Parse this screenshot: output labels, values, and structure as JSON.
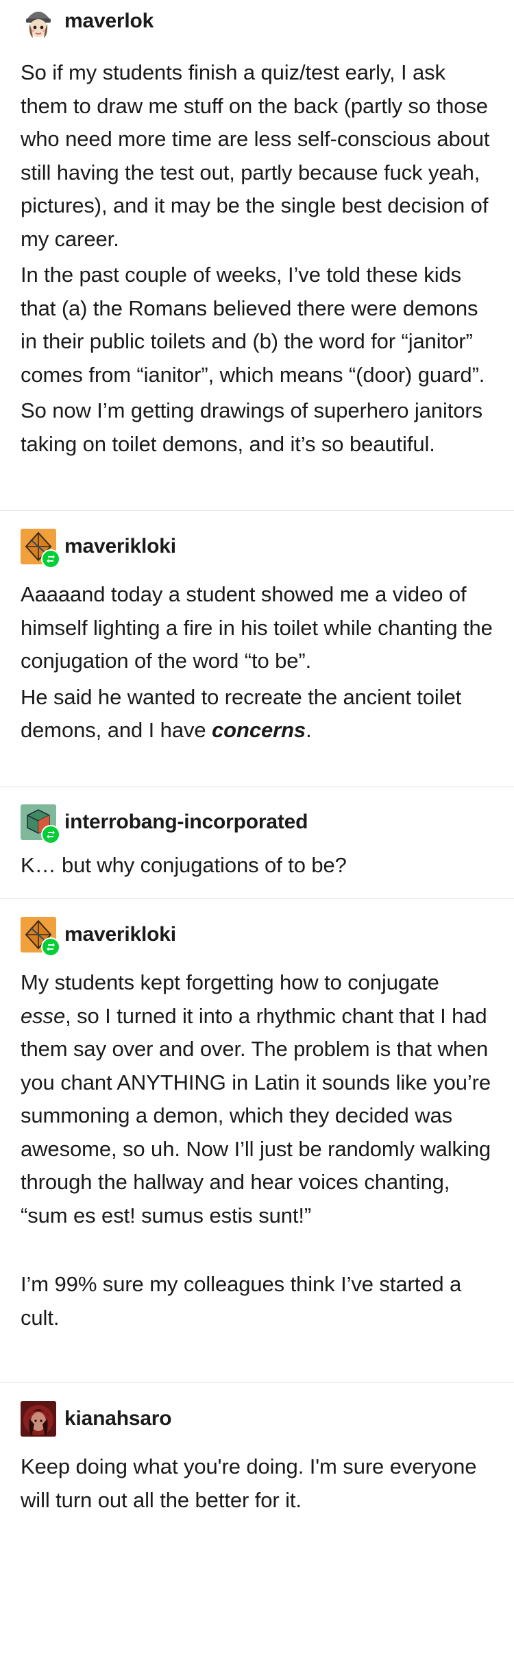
{
  "posts": [
    {
      "username": "maverlok",
      "avatar_icon": "girl-with-cap-avatar-icon",
      "paragraphs": [
        "So if my students finish a quiz/test early, I ask them to draw me stuff on the back (partly so those who need more time are less self-conscious about still having the test out, partly because fuck yeah, pictures), and it may be the single best decision of my career.",
        "In the past couple of weeks, I’ve told these kids that (a) the Romans believed there were demons in their public toilets and (b) the word for “janitor” comes from “ianitor”, which means “(door) guard”.",
        "So now I’m getting drawings of superhero janitors taking on toilet demons, and it’s so beautiful."
      ]
    },
    {
      "username": "maverikloki",
      "avatar_icon": "orange-diamond-avatar-icon",
      "reblog": true,
      "paragraphs": [
        "Aaaaand today a student showed me a video of himself lighting a fire in his toilet while chanting the conjugation of the word “to be”.",
        {
          "before": "He said he wanted to recreate the ancient toilet demons, and I have ",
          "emph": "concerns",
          "after": "."
        }
      ]
    },
    {
      "username": "interrobang-incorporated",
      "avatar_icon": "green-cube-avatar-icon",
      "reblog": true,
      "paragraphs": [
        "K… but why conjugations of to be?"
      ]
    },
    {
      "username": "maverikloki",
      "avatar_icon": "orange-diamond-avatar-icon",
      "reblog": true,
      "paragraphs": [
        {
          "before": "My students kept forgetting how to conjugate ",
          "emph": "esse",
          "after": ", so I turned it into a rhythmic chant that I had them say over and over. The problem is that when you chant ANYTHING in Latin it sounds like you’re summoning a demon, which they decided was awesome, so uh. Now I’ll just be randomly walking through the hallway and hear voices chanting, “sum es est! sumus estis sunt!”"
        },
        "I’m 99% sure my colleagues think I’ve started a cult."
      ]
    },
    {
      "username": "kianahsaro",
      "avatar_icon": "red-portrait-avatar-icon",
      "paragraphs": [
        "Keep doing what you're doing. I'm sure everyone will turn out all the better for it."
      ]
    }
  ]
}
